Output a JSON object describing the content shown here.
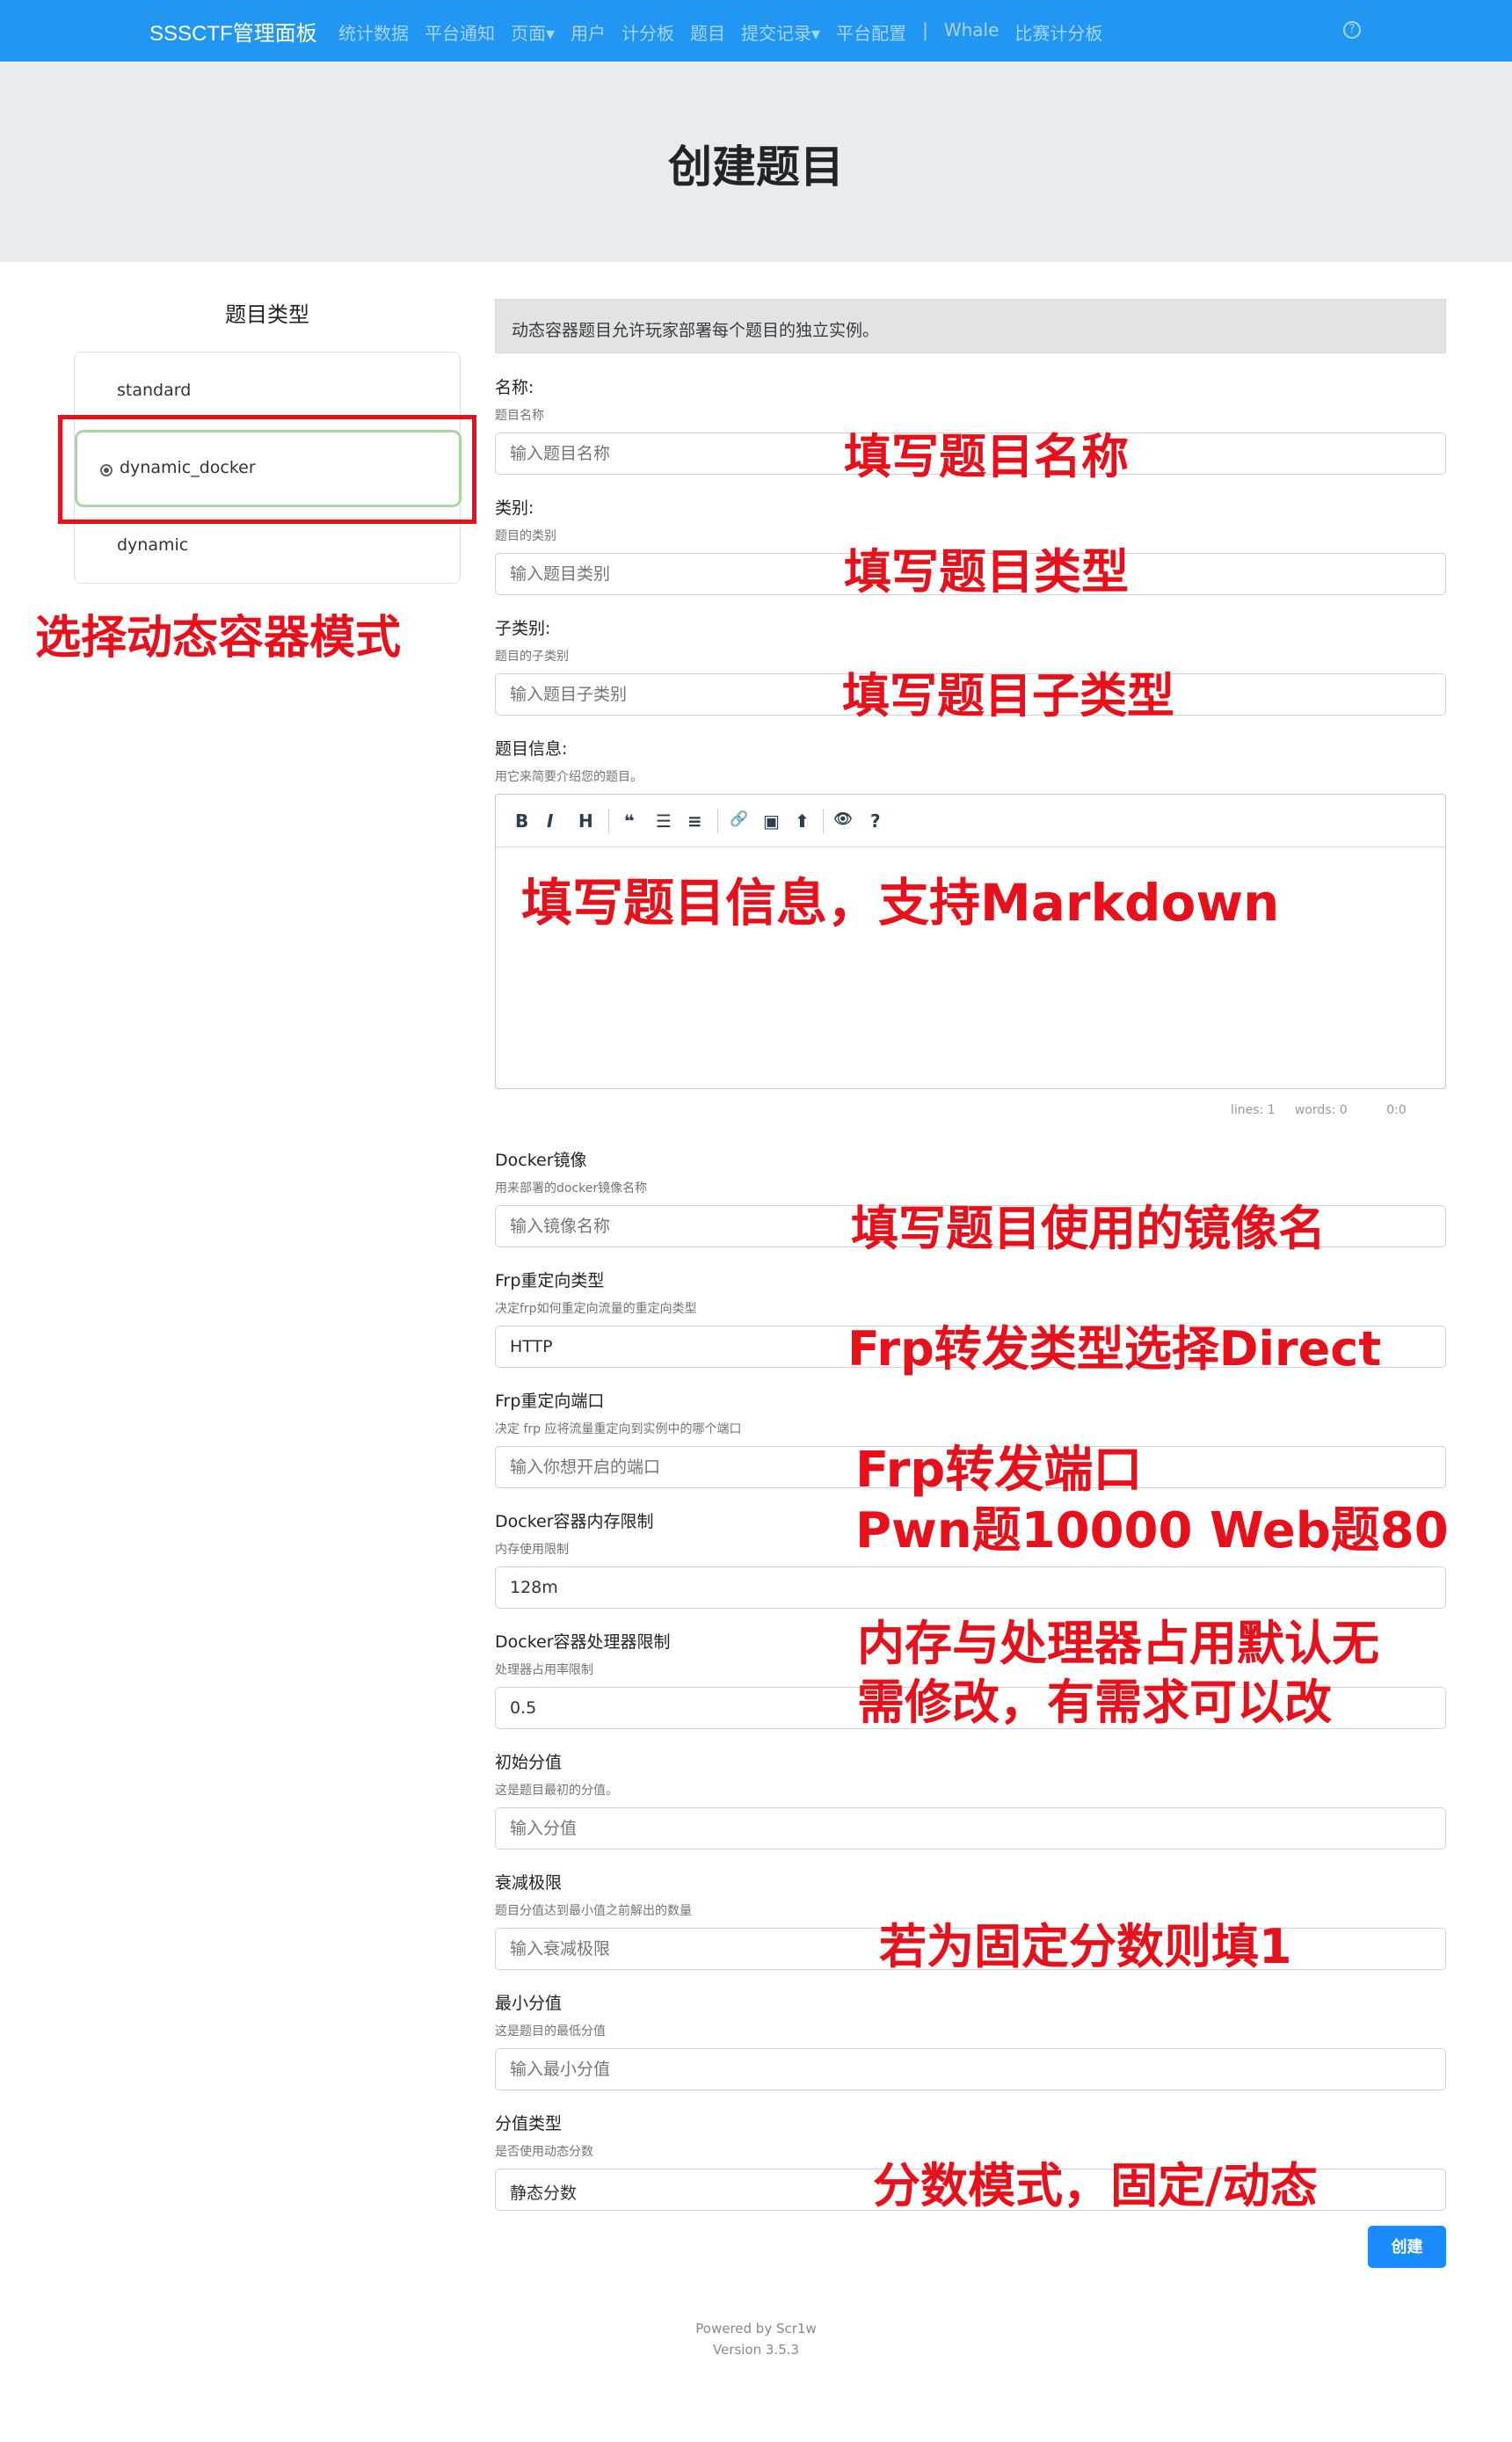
{
  "navbar": {
    "brand": "SSSCTF管理面板",
    "items": [
      "统计数据",
      "平台通知",
      "页面▾",
      "用户",
      "计分板",
      "题目",
      "提交记录▾",
      "平台配置",
      "|",
      "Whale",
      "比赛计分板"
    ],
    "help_icon": "question-circle-icon"
  },
  "header": {
    "title": "创建题目"
  },
  "challenge_type": {
    "title": "题目类型",
    "options": [
      "standard",
      "dynamic_docker",
      "dynamic"
    ],
    "selected": "dynamic_docker"
  },
  "form": {
    "info": "动态容器题目允许玩家部署每个题目的独立实例。",
    "name": {
      "label": "名称:",
      "help": "题目名称",
      "placeholder": "输入题目名称"
    },
    "category": {
      "label": "类别:",
      "help": "题目的类别",
      "placeholder": "输入题目类别"
    },
    "subcategory": {
      "label": "子类别:",
      "help": "题目的子类别",
      "placeholder": "输入题目子类别"
    },
    "description": {
      "label": "题目信息:",
      "help": "用它来简要介绍您的题目。",
      "toolbar": [
        "B",
        "I",
        "H",
        "❝",
        "☰",
        "≡",
        "🔗",
        "▣",
        "⬆",
        "👁",
        "?"
      ],
      "status": {
        "lines": "lines: 1",
        "words": "words: 0",
        "cursor": "0:0"
      }
    },
    "docker_image": {
      "label": "Docker镜像",
      "help": "用来部署的docker镜像名称",
      "placeholder": "输入镜像名称"
    },
    "frp_type": {
      "label": "Frp重定向类型",
      "help": "决定frp如何重定向流量的重定向类型",
      "value": "HTTP"
    },
    "frp_port": {
      "label": "Frp重定向端口",
      "help": "决定 frp 应将流量重定向到实例中的哪个端口",
      "placeholder": "输入你想开启的端口"
    },
    "memory": {
      "label": "Docker容器内存限制",
      "help": "内存使用限制",
      "value": "128m"
    },
    "cpu": {
      "label": "Docker容器处理器限制",
      "help": "处理器占用率限制",
      "value": "0.5"
    },
    "initial": {
      "label": "初始分值",
      "help": "这是题目最初的分值。",
      "placeholder": "输入分值"
    },
    "decay": {
      "label": "衰减极限",
      "help": "题目分值达到最小值之前解出的数量",
      "placeholder": "输入衰减极限"
    },
    "minimum": {
      "label": "最小分值",
      "help": "这是题目的最低分值",
      "placeholder": "输入最小分值"
    },
    "score_type": {
      "label": "分值类型",
      "help": "是否使用动态分数",
      "value": "静态分数"
    },
    "submit_label": "创建"
  },
  "footer": {
    "line1": "Powered by Scr1w",
    "line2": "Version 3.5.3"
  },
  "annotations": {
    "select_type": "选择动态容器模式",
    "name": "填写题目名称",
    "category": "填写题目类型",
    "subcategory": "填写题目子类型",
    "description": "填写题目信息，支持Markdown",
    "image": "填写题目使用的镜像名",
    "frp_type": "Frp转发类型选择Direct",
    "frp_port_1": "Frp转发端口",
    "frp_port_2": "Pwn题10000 Web题80",
    "resource_1": "内存与处理器占用默认无",
    "resource_2": "需修改，有需求可以改",
    "decay": "若为固定分数则填1",
    "score_type": "分数模式，固定/动态"
  },
  "colors": {
    "navbar": "#2196f3",
    "annotation": "#e8101a",
    "primary_button": "#1a8cff"
  }
}
